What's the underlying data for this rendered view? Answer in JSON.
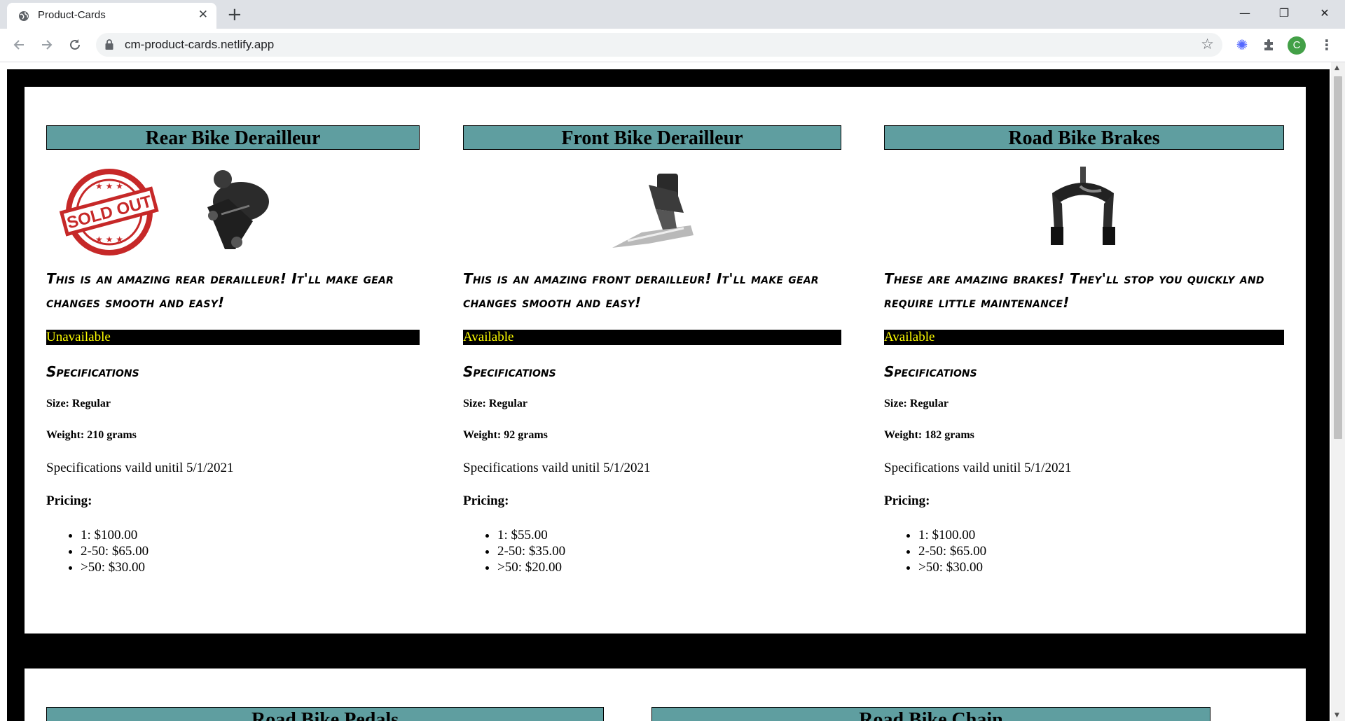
{
  "browser": {
    "tab_title": "Product-Cards",
    "tab_close": "✕",
    "new_tab": "+",
    "url": "cm-product-cards.netlify.app",
    "avatar_letter": "C",
    "window": {
      "minimize": "—",
      "maximize": "❐",
      "close": "✕"
    }
  },
  "sold_out_stamp": "SOLD OUT",
  "products": [
    {
      "name": "Rear Bike Derailleur",
      "description": "This is an amazing rear derailleur! It'll make gear changes smooth and easy!",
      "status": "Unavailable",
      "spec_heading": "Specifications",
      "size": "Size: Regular",
      "weight": "Weight: 210 grams",
      "valid": "Specifications vaild unitil 5/1/2021",
      "pricing_label": "Pricing:",
      "prices": [
        "1: $100.00",
        "2-50: $65.00",
        ">50: $30.00"
      ]
    },
    {
      "name": "Front Bike Derailleur",
      "description": "This is an amazing front derailleur! It'll make gear changes smooth and easy!",
      "status": "Available",
      "spec_heading": "Specifications",
      "size": "Size: Regular",
      "weight": "Weight: 92 grams",
      "valid": "Specifications vaild unitil 5/1/2021",
      "pricing_label": "Pricing:",
      "prices": [
        "1: $55.00",
        "2-50: $35.00",
        ">50: $20.00"
      ]
    },
    {
      "name": "Road Bike Brakes",
      "description": "These are amazing brakes! They'll stop you quickly and require little maintenance!",
      "status": "Available",
      "spec_heading": "Specifications",
      "size": "Size: Regular",
      "weight": "Weight: 182 grams",
      "valid": "Specifications vaild unitil 5/1/2021",
      "pricing_label": "Pricing:",
      "prices": [
        "1: $100.00",
        "2-50: $65.00",
        ">50: $30.00"
      ]
    },
    {
      "name": "Road Bike Pedals"
    },
    {
      "name": "Road Bike Chain"
    }
  ]
}
